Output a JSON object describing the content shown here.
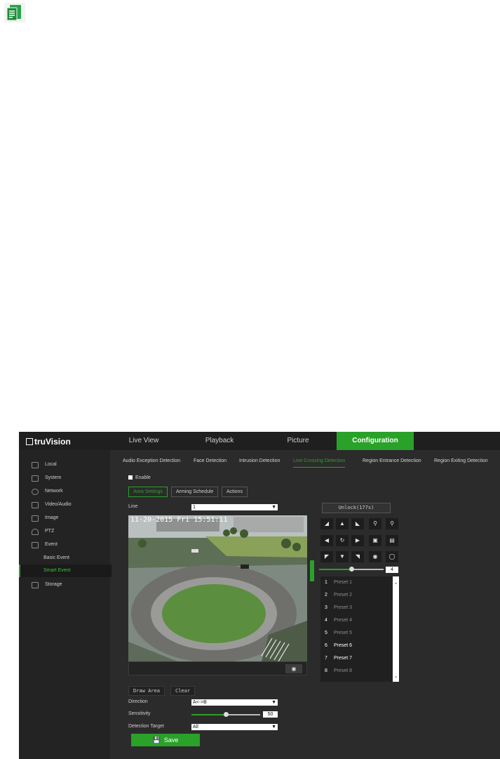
{
  "app": {
    "logo": "truVision"
  },
  "nav": [
    "Live View",
    "Playback",
    "Picture",
    "Configuration"
  ],
  "sidebar": [
    "Local",
    "System",
    "Network",
    "Video/Audio",
    "Image",
    "PTZ",
    "Event",
    "Basic Event",
    "Smart Event",
    "Storage"
  ],
  "tabs": [
    "Audio Exception Detection",
    "Face Detection",
    "Intrusion Detection",
    "Line Crossing Detection",
    "Region Entrance Detection",
    "Region Exiting Detection"
  ],
  "enable_label": "Enable",
  "subtabs": [
    "Area Settings",
    "Arming Schedule",
    "Actions"
  ],
  "line": {
    "label": "Line",
    "value": "1"
  },
  "video": {
    "timestamp": "11-20-2015  Fri 15:51:11"
  },
  "ptz": {
    "unlock": "Unlock(177s)",
    "speed": "4",
    "speed_fraction": 0.5
  },
  "presets": [
    {
      "num": "1",
      "name": "Preset 1"
    },
    {
      "num": "2",
      "name": "Preset 2"
    },
    {
      "num": "3",
      "name": "Preset 3"
    },
    {
      "num": "4",
      "name": "Preset 4"
    },
    {
      "num": "5",
      "name": "Preset 5"
    },
    {
      "num": "6",
      "name": "Preset 6"
    },
    {
      "num": "7",
      "name": "Preset 7"
    },
    {
      "num": "8",
      "name": "Preset 8"
    }
  ],
  "buttons": {
    "draw": "Draw Area",
    "clear": "Clear",
    "save": "Save"
  },
  "direction": {
    "label": "Direction",
    "value": "A<->B"
  },
  "sensitivity": {
    "label": "Sensitivity",
    "value": "50",
    "fraction": 0.5
  },
  "target": {
    "label": "Detection Target",
    "value": "All"
  },
  "colors": {
    "accent": "#2aa129",
    "background": "#2b2b2b"
  }
}
